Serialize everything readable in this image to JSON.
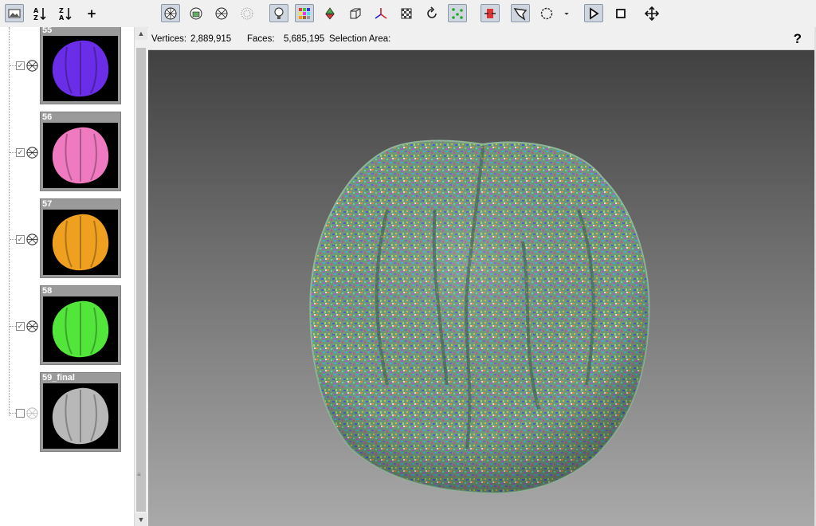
{
  "toolbar": {
    "buttons": [
      {
        "name": "image-view-button",
        "icon": "image-icon",
        "active": true
      },
      {
        "name": "sort-ascending-button",
        "icon": "sort-az-icon"
      },
      {
        "name": "sort-descending-button",
        "icon": "sort-za-icon"
      },
      {
        "name": "add-layer-button",
        "icon": "plus-icon",
        "label": "+"
      },
      {
        "name": "mesh-view-button",
        "icon": "mesh-icon",
        "active": true
      },
      {
        "name": "texture-view-button",
        "icon": "texture-icon"
      },
      {
        "name": "wireframe-view-button",
        "icon": "wireframe-icon"
      },
      {
        "name": "points-view-button",
        "icon": "points-icon"
      },
      {
        "name": "light-button",
        "icon": "lightbulb-icon",
        "active": true
      },
      {
        "name": "color-grid-button",
        "icon": "color-grid-icon",
        "active": true
      },
      {
        "name": "recycle-button",
        "icon": "recycle-icon"
      },
      {
        "name": "bounding-box-button",
        "icon": "cube-icon"
      },
      {
        "name": "axes-button",
        "icon": "axes-icon"
      },
      {
        "name": "checker-button",
        "icon": "checker-icon"
      },
      {
        "name": "rotate-button",
        "icon": "rotate-icon"
      },
      {
        "name": "vertices-button",
        "icon": "vertices-icon",
        "active": true
      },
      {
        "name": "split-button",
        "icon": "split-icon",
        "active": true
      },
      {
        "name": "lasso-select-button",
        "icon": "lasso-icon",
        "active": true
      },
      {
        "name": "circle-select-button",
        "icon": "circle-dashed-icon"
      },
      {
        "name": "select-mode-dropdown",
        "icon": "dropdown-arrow-icon"
      },
      {
        "name": "play-button",
        "icon": "play-icon",
        "active": true
      },
      {
        "name": "stop-button",
        "icon": "stop-icon"
      },
      {
        "name": "move-button",
        "icon": "move-icon"
      }
    ]
  },
  "layers": [
    {
      "name": "55",
      "checked": true,
      "color": "#6a2ee8"
    },
    {
      "name": "56",
      "checked": true,
      "color": "#f07ac0"
    },
    {
      "name": "57",
      "checked": true,
      "color": "#f0a020"
    },
    {
      "name": "58",
      "checked": true,
      "color": "#52e63a"
    },
    {
      "name": "59_final",
      "checked": false,
      "color": "#b8b8b8"
    }
  ],
  "info": {
    "vertices_label": "Vertices:",
    "vertices_value": "2,889,915",
    "faces_label": "Faces:",
    "faces_value": "5,685,195",
    "selection_label": "Selection Area:",
    "help": "?"
  }
}
